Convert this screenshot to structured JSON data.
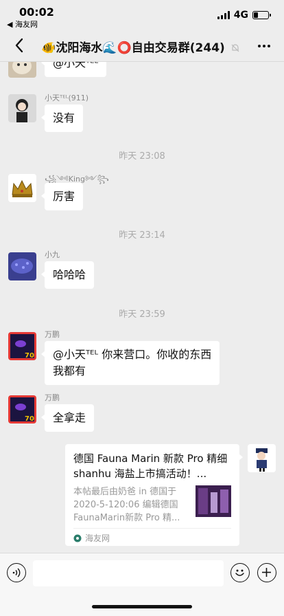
{
  "status_bar": {
    "time": "00:02",
    "back_app": "◀ 海友网",
    "network": "4G",
    "battery_level": 0.3
  },
  "nav": {
    "title": "🐠沈阳海水🌊⭕自由交易群(244)"
  },
  "messages": [
    {
      "sender": "",
      "text": "@小天ᵀᴱᴸ",
      "avatar": "dog-avatar"
    },
    {
      "sender": "小天ᵀᴱᴸ(911)",
      "text": "没有",
      "avatar": "boy-avatar"
    },
    {
      "sender": "꧁༺King༻꧂",
      "text": "厉害",
      "avatar": "crown-avatar"
    },
    {
      "sender": "小九",
      "text": "哈哈哈",
      "avatar": "coral-avatar"
    },
    {
      "sender": "万鹏",
      "text_line1": "@小天ᵀᴱᴸ 你来营口。你收的东西",
      "text_line2": "我都有",
      "avatar": "fish-avatar"
    },
    {
      "sender": "万鹏",
      "text": "全拿走",
      "avatar": "fish-avatar"
    }
  ],
  "time_separators": [
    "昨天 23:08",
    "昨天 23:14",
    "昨天 23:59"
  ],
  "link_card": {
    "title": "德国 Fauna Marin 新款 Pro 精细 shanhu 海盐上市搞活动！...",
    "desc": "本帖最后由奶爸 in 德国于 2020-5-120:06 编辑德国 FaunaMarin新款 Pro 精...",
    "source": "海友网",
    "avatar": "sailor-avatar"
  },
  "input_bar": {
    "placeholder": ""
  }
}
